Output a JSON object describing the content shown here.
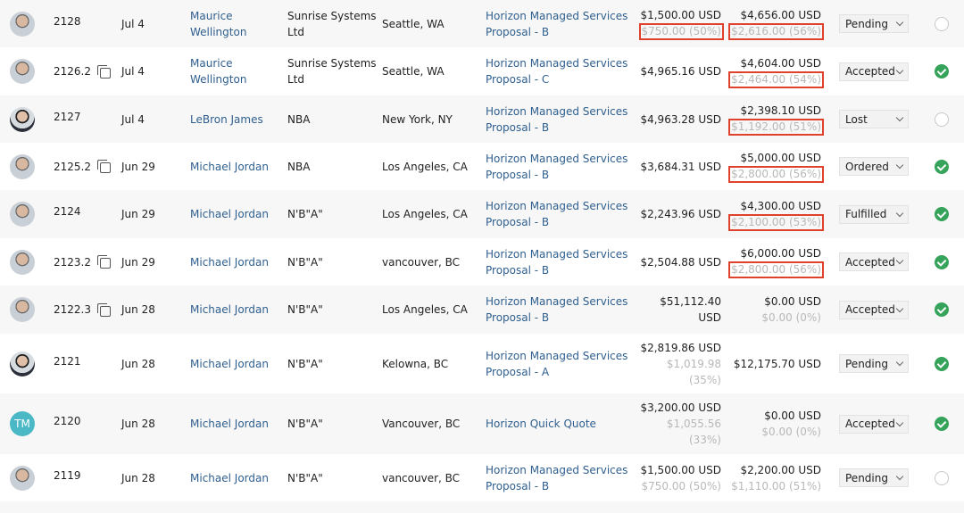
{
  "colors": {
    "link": "#2f5f8f",
    "muted_amount": "#b8b8b8",
    "highlight_box": "#e0412c",
    "accepted_check": "#35a35a",
    "row_alt_bg": "#f7f7f7",
    "initials_avatar": "#4bb8c6"
  },
  "rows": [
    {
      "number": "2128",
      "has_copy_icon": false,
      "date": "Jul 4",
      "contact": [
        "Maurice",
        "Wellington"
      ],
      "company": [
        "Sunrise Systems",
        "Ltd"
      ],
      "location": "Seattle, WA",
      "proposal": [
        "Horizon Managed Services",
        "Proposal - B"
      ],
      "amount1": [
        "$1,500.00 USD"
      ],
      "amount1_sub": [
        "$750.00 (50%)"
      ],
      "amount1_boxed": true,
      "amount2": [
        "$4,656.00 USD"
      ],
      "amount2_sub": [
        "$2,616.00 (56%)"
      ],
      "amount2_boxed": true,
      "status": "Pending",
      "checked": false,
      "avatar": {
        "type": "photo",
        "initials": ""
      }
    },
    {
      "number": "2126.2",
      "has_copy_icon": true,
      "date": "Jul 4",
      "contact": [
        "Maurice",
        "Wellington"
      ],
      "company": [
        "Sunrise Systems",
        "Ltd"
      ],
      "location": "Seattle, WA",
      "proposal": [
        "Horizon Managed Services",
        "Proposal - C"
      ],
      "amount1": [
        "$4,965.16 USD"
      ],
      "amount1_sub": [],
      "amount1_boxed": false,
      "amount2": [
        "$4,604.00 USD"
      ],
      "amount2_sub": [
        "$2,464.00 (54%)"
      ],
      "amount2_boxed": true,
      "status": "Accepted",
      "checked": true,
      "avatar": {
        "type": "photo",
        "initials": ""
      }
    },
    {
      "number": "2127",
      "has_copy_icon": false,
      "date": "Jul 4",
      "contact": [
        "LeBron James"
      ],
      "company": [
        "NBA"
      ],
      "location": "New York, NY",
      "proposal": [
        "Horizon Managed Services",
        "Proposal - B"
      ],
      "amount1": [
        "$4,963.28 USD"
      ],
      "amount1_sub": [],
      "amount1_boxed": false,
      "amount2": [
        "$2,398.10 USD"
      ],
      "amount2_sub": [
        "$1,192.00 (51%)"
      ],
      "amount2_boxed": true,
      "status": "Lost",
      "checked": false,
      "avatar": {
        "type": "photo-dark",
        "initials": ""
      }
    },
    {
      "number": "2125.2",
      "has_copy_icon": true,
      "date": "Jun 29",
      "contact": [
        "Michael Jordan"
      ],
      "company": [
        "NBA"
      ],
      "location": "Los Angeles, CA",
      "proposal": [
        "Horizon Managed Services",
        "Proposal - B"
      ],
      "amount1": [
        "$3,684.31 USD"
      ],
      "amount1_sub": [],
      "amount1_boxed": false,
      "amount2": [
        "$5,000.00 USD"
      ],
      "amount2_sub": [
        "$2,800.00 (56%)"
      ],
      "amount2_boxed": true,
      "status": "Ordered",
      "checked": true,
      "avatar": {
        "type": "photo",
        "initials": ""
      }
    },
    {
      "number": "2124",
      "has_copy_icon": false,
      "date": "Jun 29",
      "contact": [
        "Michael Jordan"
      ],
      "company": [
        "N'B\"A\""
      ],
      "location": "Los Angeles, CA",
      "proposal": [
        "Horizon Managed Services",
        "Proposal - B"
      ],
      "amount1": [
        "$2,243.96 USD"
      ],
      "amount1_sub": [],
      "amount1_boxed": false,
      "amount2": [
        "$4,300.00 USD"
      ],
      "amount2_sub": [
        "$2,100.00 (53%)"
      ],
      "amount2_boxed": true,
      "status": "Fulfilled",
      "checked": true,
      "avatar": {
        "type": "photo",
        "initials": ""
      }
    },
    {
      "number": "2123.2",
      "has_copy_icon": true,
      "date": "Jun 29",
      "contact": [
        "Michael Jordan"
      ],
      "company": [
        "N'B\"A\""
      ],
      "location": "vancouver, BC",
      "proposal": [
        "Horizon Managed Services",
        "Proposal - B"
      ],
      "amount1": [
        "$2,504.88 USD"
      ],
      "amount1_sub": [],
      "amount1_boxed": false,
      "amount2": [
        "$6,000.00 USD"
      ],
      "amount2_sub": [
        "$2,800.00 (56%)"
      ],
      "amount2_boxed": true,
      "status": "Accepted",
      "checked": true,
      "avatar": {
        "type": "photo",
        "initials": ""
      }
    },
    {
      "number": "2122.3",
      "has_copy_icon": true,
      "date": "Jun 28",
      "contact": [
        "Michael Jordan"
      ],
      "company": [
        "N'B\"A\""
      ],
      "location": "Los Angeles, CA",
      "proposal": [
        "Horizon Managed Services",
        "Proposal - B"
      ],
      "amount1": [
        "$51,112.40",
        "USD"
      ],
      "amount1_sub": [],
      "amount1_boxed": false,
      "amount2": [
        "$0.00 USD"
      ],
      "amount2_sub": [
        "$0.00 (0%)"
      ],
      "amount2_boxed": false,
      "status": "Accepted",
      "checked": true,
      "avatar": {
        "type": "photo",
        "initials": ""
      }
    },
    {
      "number": "2121",
      "has_copy_icon": false,
      "date": "Jun 28",
      "contact": [
        "Michael Jordan"
      ],
      "company": [
        "N'B\"A\""
      ],
      "location": "Kelowna, BC",
      "proposal": [
        "Horizon Managed Services",
        "Proposal - A"
      ],
      "amount1": [
        "$2,819.86 USD"
      ],
      "amount1_sub": [
        "$1,019.98",
        "(35%)"
      ],
      "amount1_boxed": false,
      "amount2": [
        "$12,175.70 USD"
      ],
      "amount2_sub": [],
      "amount2_boxed": false,
      "status": "Pending",
      "checked": true,
      "avatar": {
        "type": "photo-dark",
        "initials": ""
      }
    },
    {
      "number": "2120",
      "has_copy_icon": false,
      "date": "Jun 28",
      "contact": [
        "Michael Jordan"
      ],
      "company": [
        "N'B\"A\""
      ],
      "location": "Vancouver, BC",
      "proposal": [
        "Horizon Quick Quote"
      ],
      "amount1": [
        "$3,200.00 USD"
      ],
      "amount1_sub": [
        "$1,055.56",
        "(33%)"
      ],
      "amount1_boxed": false,
      "amount2": [
        "$0.00 USD"
      ],
      "amount2_sub": [
        "$0.00 (0%)"
      ],
      "amount2_boxed": false,
      "status": "Accepted",
      "checked": true,
      "avatar": {
        "type": "initials",
        "initials": "TM"
      }
    },
    {
      "number": "2119",
      "has_copy_icon": false,
      "date": "Jun 28",
      "contact": [
        "Michael Jordan"
      ],
      "company": [
        "N'B\"A\""
      ],
      "location": "vancouver, BC",
      "proposal": [
        "Horizon Managed Services",
        "Proposal - B"
      ],
      "amount1": [
        "$1,500.00 USD"
      ],
      "amount1_sub": [
        "$750.00 (50%)"
      ],
      "amount1_boxed": false,
      "amount2": [
        "$2,200.00 USD"
      ],
      "amount2_sub": [
        "$1,110.00 (51%)"
      ],
      "amount2_boxed": false,
      "status": "Pending",
      "checked": false,
      "avatar": {
        "type": "photo",
        "initials": ""
      }
    }
  ]
}
